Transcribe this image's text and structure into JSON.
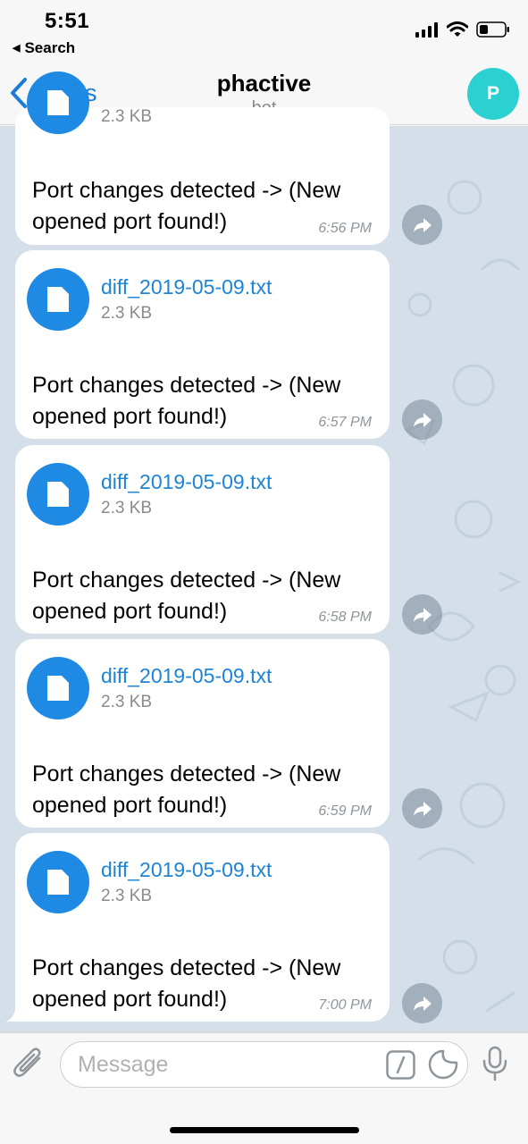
{
  "status_bar": {
    "time": "5:51",
    "back_label": "Search"
  },
  "header": {
    "back_label": "Chats",
    "title": "phactive",
    "subtitle": "bot",
    "avatar_initial": "P"
  },
  "messages": [
    {
      "file_name": "",
      "file_size": "2.3 KB",
      "text": "Port changes detected -> (New opened port found!)",
      "time": "6:56 PM"
    },
    {
      "file_name": "diff_2019-05-09.txt",
      "file_size": "2.3 KB",
      "text": "Port changes detected -> (New opened port found!)",
      "time": "6:57 PM"
    },
    {
      "file_name": "diff_2019-05-09.txt",
      "file_size": "2.3 KB",
      "text": "Port changes detected -> (New opened port found!)",
      "time": "6:58 PM"
    },
    {
      "file_name": "diff_2019-05-09.txt",
      "file_size": "2.3 KB",
      "text": "Port changes detected -> (New opened port found!)",
      "time": "6:59 PM"
    },
    {
      "file_name": "diff_2019-05-09.txt",
      "file_size": "2.3 KB",
      "text": "Port changes detected -> (New opened port found!)",
      "time": "7:00 PM"
    }
  ],
  "composer": {
    "placeholder": "Message"
  },
  "icons": {
    "status": [
      "signal-icon",
      "wifi-icon",
      "battery-icon"
    ],
    "header": [
      "chevron-left-icon"
    ],
    "message": [
      "document-icon",
      "forward-icon"
    ],
    "composer": [
      "paperclip-icon",
      "slash-command-icon",
      "sticker-icon",
      "microphone-icon"
    ]
  },
  "colors": {
    "accent": "#1c7cd6",
    "file_icon": "#1f8ae4",
    "avatar": "#2bd0d0",
    "chat_background": "#d5dfea"
  }
}
